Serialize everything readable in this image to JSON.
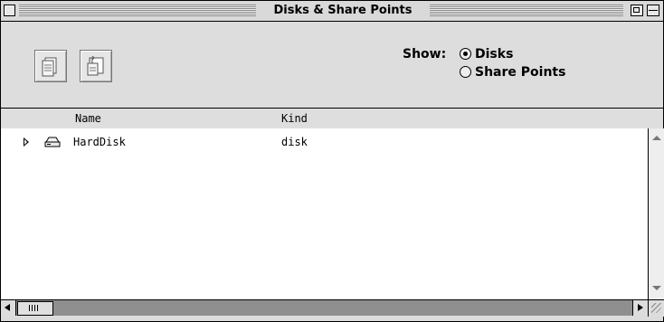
{
  "window": {
    "title": "Disks & Share Points"
  },
  "toolbar": {
    "buttons": [
      {
        "icon": "document-icon"
      },
      {
        "icon": "share-document-icon"
      }
    ]
  },
  "show": {
    "label": "Show:",
    "options": [
      {
        "label": "Disks",
        "selected": true
      },
      {
        "label": "Share Points",
        "selected": false
      }
    ]
  },
  "columns": {
    "name": "Name",
    "kind": "Kind"
  },
  "rows": [
    {
      "name": "HardDisk",
      "kind": "disk",
      "icon": "hard-disk-icon",
      "expanded": false
    }
  ]
}
